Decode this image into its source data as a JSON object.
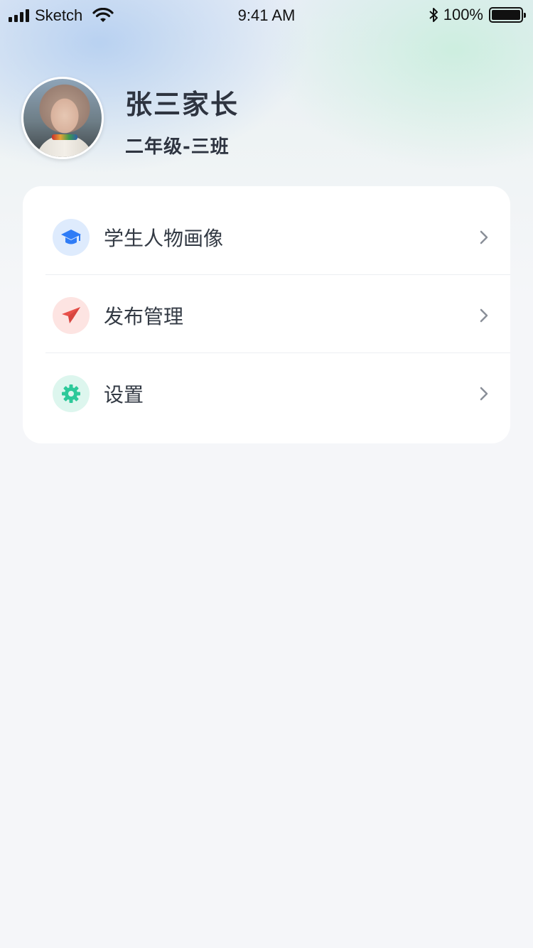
{
  "status_bar": {
    "carrier": "Sketch",
    "time": "9:41 AM",
    "battery": "100%"
  },
  "profile": {
    "name": "张三家长",
    "class": "二年级-三班"
  },
  "menu": {
    "items": [
      {
        "label": "学生人物画像",
        "icon": "graduation-cap-icon",
        "icon_color": "#2f7cf6",
        "icon_bg": "#deebfd"
      },
      {
        "label": "发布管理",
        "icon": "paper-plane-icon",
        "icon_color": "#e8504a",
        "icon_bg": "#fde4e2"
      },
      {
        "label": "设置",
        "icon": "gear-icon",
        "icon_color": "#2dc99a",
        "icon_bg": "#ddf6ee"
      }
    ]
  }
}
